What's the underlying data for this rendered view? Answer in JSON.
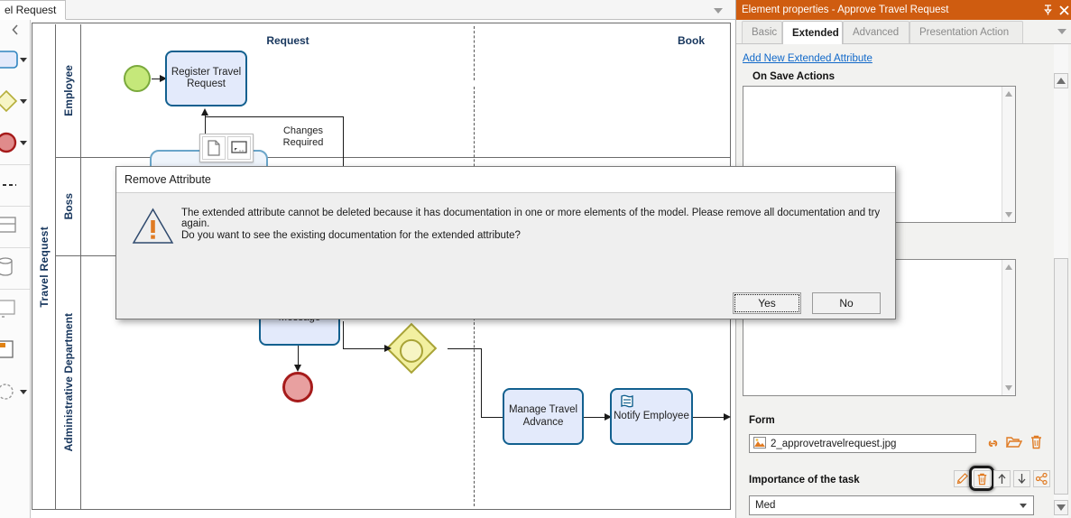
{
  "tabbar": {
    "active_tab": "el Request",
    "overflow_icon": "chevron-down-icon"
  },
  "palette": {
    "collapse_icon": "chevron-left-icon",
    "items": [
      {
        "name": "task-tool",
        "icon": "task-icon"
      },
      {
        "name": "gateway-tool",
        "icon": "gateway-icon"
      },
      {
        "name": "end-event-tool",
        "icon": "end-event-icon"
      },
      {
        "name": "association-tool",
        "icon": "dashed-line-icon"
      },
      {
        "name": "data-object-tool",
        "icon": "data-object-icon"
      },
      {
        "name": "data-store-tool",
        "icon": "data-store-icon"
      },
      {
        "name": "group-tool",
        "icon": "group-icon"
      },
      {
        "name": "annotation-tool",
        "icon": "annotation-icon"
      },
      {
        "name": "artifact-tool",
        "icon": "artifact-icon"
      }
    ]
  },
  "diagram": {
    "pool_title": "Travel Request",
    "lanes": [
      {
        "label": "Employee"
      },
      {
        "label": "Boss"
      },
      {
        "label": "Administrative Department"
      }
    ],
    "labels": {
      "request": "Request",
      "book": "Book",
      "changes_required": "Changes\nRequired",
      "changes_required_line1": "Changes",
      "changes_required_line2": "Required"
    },
    "nodes": [
      {
        "name": "start-event",
        "type": "start-event",
        "label": ""
      },
      {
        "name": "task-register-travel-request",
        "type": "task",
        "label": "Register Travel\nRequest",
        "line1": "Register Travel",
        "line2": "Request"
      },
      {
        "name": "task-message",
        "type": "task",
        "label": "Message"
      },
      {
        "name": "end-event",
        "type": "end-event",
        "label": ""
      },
      {
        "name": "gateway-inclusive",
        "type": "gateway",
        "label": ""
      },
      {
        "name": "task-manage-travel-advance",
        "type": "task",
        "label": "Manage Travel\nAdvance",
        "line1": "Manage Travel",
        "line2": "Advance"
      },
      {
        "name": "task-notify-employee",
        "type": "task",
        "label": "Notify Employee",
        "icon": "script-task-icon"
      }
    ],
    "context_toolbar": [
      {
        "name": "document-icon"
      },
      {
        "name": "screen-icon"
      }
    ]
  },
  "panel": {
    "title": "Element properties - Approve Travel Request",
    "pin_icon": "pin-icon",
    "close_icon": "close-icon",
    "tabs": [
      {
        "label": "Basic",
        "selected": false
      },
      {
        "label": "Extended",
        "selected": true
      },
      {
        "label": "Advanced",
        "selected": false
      },
      {
        "label": "Presentation Action",
        "selected": false
      }
    ],
    "overflow_icon": "chevron-down-icon",
    "add_attribute_link": "Add New Extended Attribute",
    "on_save_actions_label": "On Save Actions",
    "on_save_actions_value": "",
    "second_textarea_value": "",
    "form_label": "Form",
    "form_value": "2_approvetravelrequest.jpg",
    "form_value_icon": "image-file-icon",
    "form_actions": [
      {
        "name": "link-icon"
      },
      {
        "name": "open-folder-icon"
      },
      {
        "name": "trash-icon"
      }
    ],
    "importance_label": "Importance of the task",
    "importance_value": "Med",
    "importance_actions": [
      {
        "name": "edit-pencil-icon",
        "focused": false
      },
      {
        "name": "trash-icon",
        "focused": true
      },
      {
        "name": "move-up-icon",
        "focused": false
      },
      {
        "name": "move-down-icon",
        "focused": false
      },
      {
        "name": "share-icon",
        "focused": false
      }
    ],
    "accent_color": "#cf5c10",
    "link_color": "#1068c9"
  },
  "dialog": {
    "title": "Remove Attribute",
    "warning_icon": "warning-triangle-icon",
    "message_line1": "The extended attribute cannot be deleted because it has documentation in one or more elements of the model. Please remove all documentation and try again.",
    "message_line2": "Do you want to see the existing documentation for the extended attribute?",
    "buttons": [
      {
        "label": "Yes",
        "focused": true
      },
      {
        "label": "No",
        "focused": false
      }
    ]
  }
}
